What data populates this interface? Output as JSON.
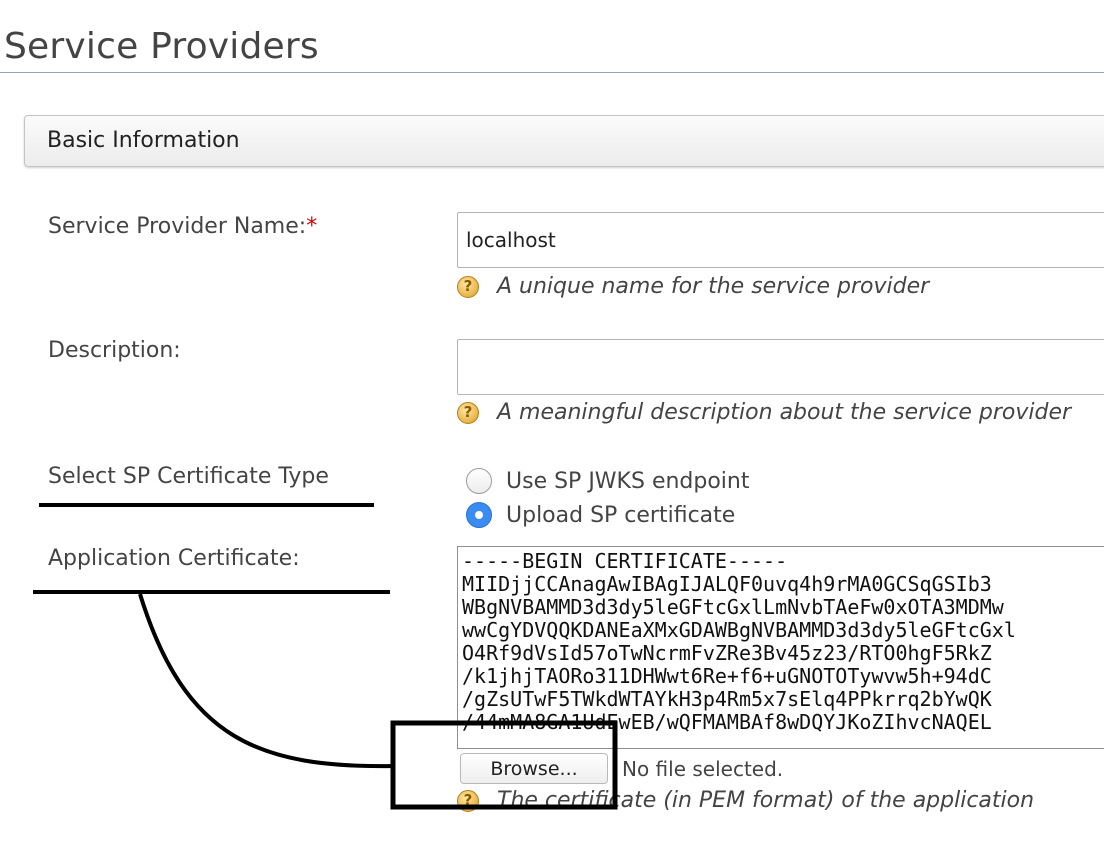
{
  "page": {
    "title": "Service Providers"
  },
  "section": {
    "header": "Basic Information"
  },
  "fields": {
    "name": {
      "label": "Service Provider Name:",
      "required_mark": "*",
      "value": "localhost",
      "hint": "A unique name for the service provider"
    },
    "description": {
      "label": "Description:",
      "value": "",
      "hint": "A meaningful description about the service provider"
    },
    "cert_type": {
      "label": "Select SP Certificate Type",
      "options": [
        {
          "label": "Use SP JWKS endpoint",
          "selected": false
        },
        {
          "label": "Upload SP certificate",
          "selected": true
        }
      ]
    },
    "application_cert": {
      "label": "Application Certificate:",
      "lines": [
        "-----BEGIN CERTIFICATE-----",
        "MIIDjjCCAnagAwIBAgIJALQF0uvq4h9rMA0GCSqGSIb3",
        "WBgNVBAMMD3d3dy5leGFtcGxlLmNvbTAeFw0xOTA3MDMw",
        "wwCgYDVQQKDANEaXMxGDAWBgNVBAMMD3d3dy5leGFtcGxl",
        "O4Rf9dVsId57oTwNcrmFvZRe3Bv45z23/RTO0hgF5RkZ",
        "/k1jhjTAORo311DHWwt6Re+f6+uGNOTOTywvw5h+94dC",
        "/gZsUTwF5TWkdWTAYkH3p4Rm5x7sElq4PPkrrq2bYwQK",
        "/44mMA8GA1UdEwEB/wQFMAMBAf8wDQYJKoZIhvcNAQEL"
      ],
      "browse_label": "Browse...",
      "file_status": "No file selected.",
      "hint": "The certificate (in PEM format) of the application"
    }
  },
  "icons": {
    "help": "help-question-icon"
  },
  "colors": {
    "accent_radio": "#3b8cf0",
    "required": "#dd0000"
  }
}
